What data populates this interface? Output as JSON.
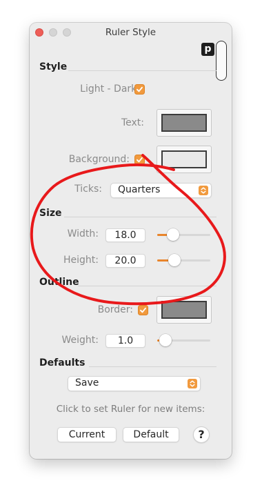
{
  "window": {
    "title": "Ruler Style",
    "badge": "p"
  },
  "style": {
    "section_title": "Style",
    "light_dark_label": "Light - Dark:",
    "light_dark_checked": true,
    "text_label": "Text:",
    "background_label": "Background:",
    "background_checked": true,
    "ticks_label": "Ticks:",
    "ticks_value": "Quarters"
  },
  "size": {
    "section_title": "Size",
    "width_label": "Width:",
    "width_value": "18.0",
    "width_slider_fraction": 0.3,
    "height_label": "Height:",
    "height_value": "20.0",
    "height_slider_fraction": 0.32
  },
  "outline": {
    "section_title": "Outline",
    "border_label": "Border:",
    "border_checked": true,
    "weight_label": "Weight:",
    "weight_value": "1.0",
    "weight_slider_fraction": 0.15
  },
  "defaults": {
    "section_title": "Defaults",
    "popup_value": "Save",
    "hint": "Click to set Ruler for new items:",
    "current_button": "Current",
    "default_button": "Default",
    "help_button": "?"
  },
  "colors": {
    "accent": "#f19a3e",
    "text_well_fill": "#8a8a8a",
    "background_well_fill": "#e9e9e9",
    "border_well_fill": "#8a8a8a",
    "annotation_red": "#e8191b"
  }
}
